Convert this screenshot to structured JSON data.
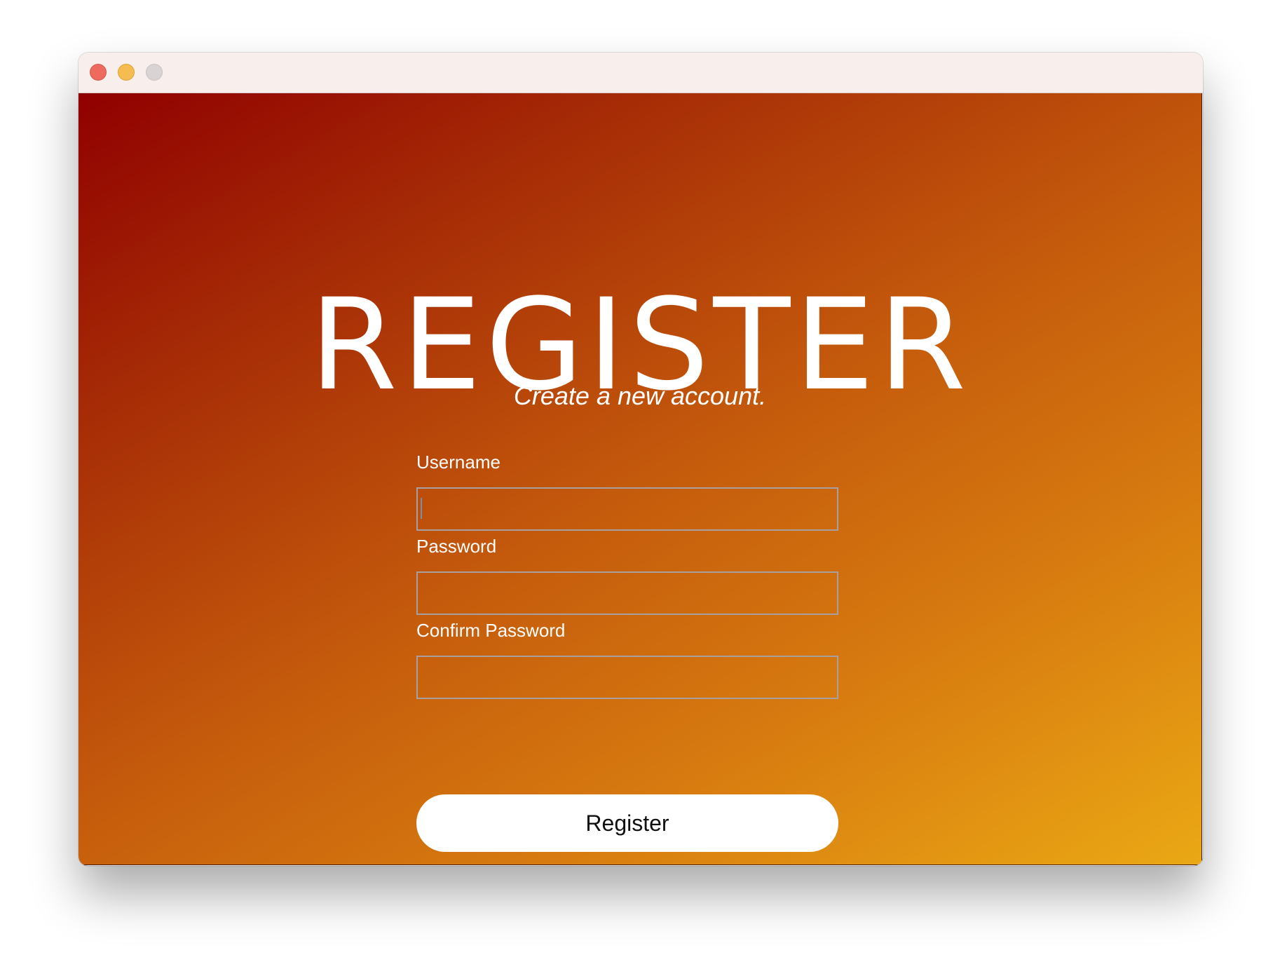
{
  "window": {
    "traffic_lights": [
      "close",
      "minimize",
      "zoom"
    ]
  },
  "header": {
    "title": "REGISTER",
    "subtitle": "Create a new account."
  },
  "form": {
    "fields": [
      {
        "label": "Username",
        "value": "",
        "type": "text",
        "focused": true
      },
      {
        "label": "Password",
        "value": "",
        "type": "password"
      },
      {
        "label": "Confirm Password",
        "value": "",
        "type": "password"
      }
    ],
    "submit_label": "Register"
  },
  "colors": {
    "gradient_start": "#900000",
    "gradient_end": "#eaa814",
    "text": "#ffffff",
    "button_bg": "#ffffff"
  }
}
